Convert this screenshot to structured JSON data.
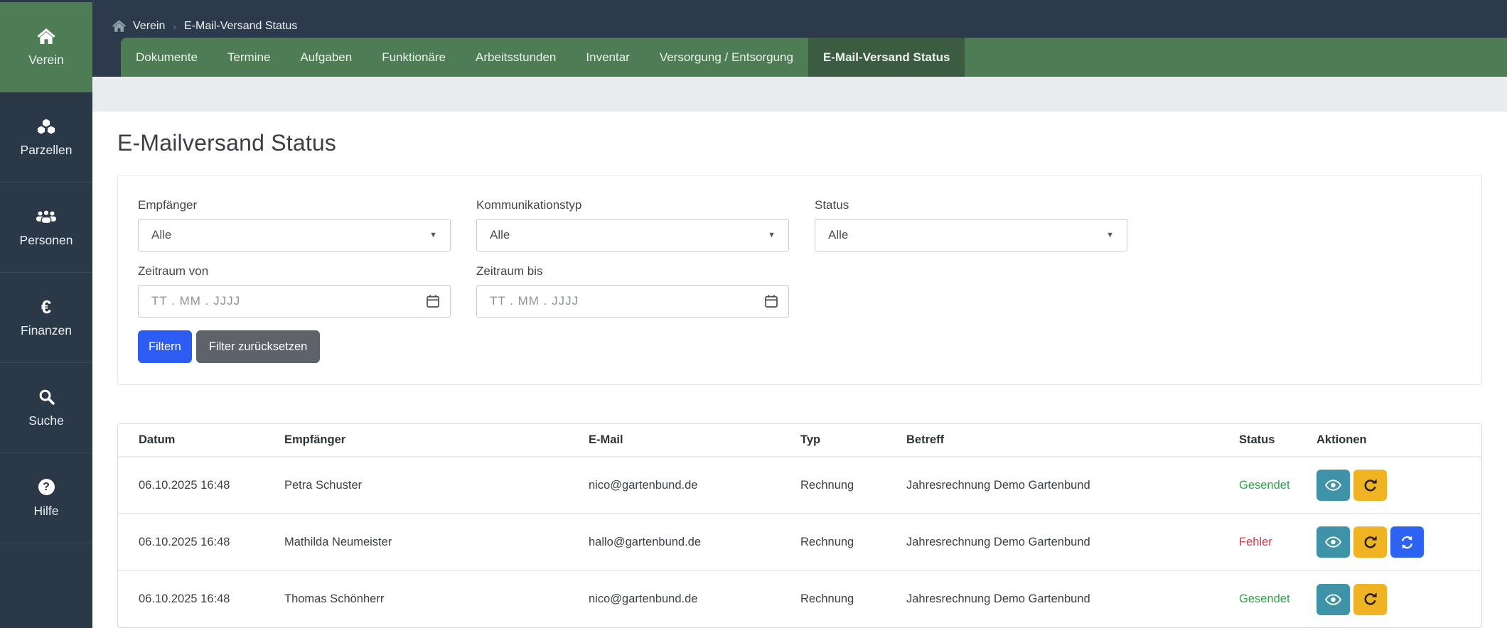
{
  "sidebar": {
    "items": [
      {
        "icon": "home-icon",
        "label": "Verein",
        "active": true
      },
      {
        "icon": "cubes-icon",
        "label": "Parzellen",
        "active": false
      },
      {
        "icon": "users-icon",
        "label": "Personen",
        "active": false
      },
      {
        "icon": "euro-icon",
        "label": "Finanzen",
        "active": false
      },
      {
        "icon": "search-icon",
        "label": "Suche",
        "active": false
      },
      {
        "icon": "help-icon",
        "label": "Hilfe",
        "active": false
      }
    ]
  },
  "breadcrumb": {
    "items": [
      "Verein",
      "E-Mail-Versand Status"
    ]
  },
  "tabs": [
    {
      "label": "Dokumente",
      "active": false
    },
    {
      "label": "Termine",
      "active": false
    },
    {
      "label": "Aufgaben",
      "active": false
    },
    {
      "label": "Funktionäre",
      "active": false
    },
    {
      "label": "Arbeitsstunden",
      "active": false
    },
    {
      "label": "Inventar",
      "active": false
    },
    {
      "label": "Versorgung / Entsorgung",
      "active": false
    },
    {
      "label": "E-Mail-Versand Status",
      "active": true
    }
  ],
  "page": {
    "title": "E-Mailversand Status"
  },
  "filters": {
    "empfaenger": {
      "label": "Empfänger",
      "value": "Alle"
    },
    "kommunikationstyp": {
      "label": "Kommunikationstyp",
      "value": "Alle"
    },
    "status": {
      "label": "Status",
      "value": "Alle"
    },
    "zeitraum_von": {
      "label": "Zeitraum von",
      "placeholder": "TT . MM . JJJJ"
    },
    "zeitraum_bis": {
      "label": "Zeitraum bis",
      "placeholder": "TT . MM . JJJJ"
    },
    "filter_button": "Filtern",
    "reset_button": "Filter zurücksetzen"
  },
  "table": {
    "columns": [
      "Datum",
      "Empfänger",
      "E-Mail",
      "Typ",
      "Betreff",
      "Status",
      "Aktionen"
    ],
    "rows": [
      {
        "datum": "06.10.2025 16:48",
        "empfaenger": "Petra Schuster",
        "email": "nico@gartenbund.de",
        "typ": "Rechnung",
        "betreff": "Jahresrechnung Demo Gartenbund",
        "status": "Gesendet",
        "status_type": "success",
        "actions": [
          "view",
          "resend"
        ]
      },
      {
        "datum": "06.10.2025 16:48",
        "empfaenger": "Mathilda Neumeister",
        "email": "hallo@gartenbund.de",
        "typ": "Rechnung",
        "betreff": "Jahresrechnung Demo Gartenbund",
        "status": "Fehler",
        "status_type": "error",
        "actions": [
          "view",
          "resend",
          "retry"
        ]
      },
      {
        "datum": "06.10.2025 16:48",
        "empfaenger": "Thomas Schönherr",
        "email": "nico@gartenbund.de",
        "typ": "Rechnung",
        "betreff": "Jahresrechnung Demo Gartenbund",
        "status": "Gesendet",
        "status_type": "success",
        "actions": [
          "view",
          "resend"
        ]
      }
    ]
  },
  "colors": {
    "sidebar_dark": "#2b3847",
    "header_dark": "#2c3a4b",
    "nav_green": "#4e7d55",
    "nav_green_active": "#3c5c42",
    "primary_blue": "#2c5cf2",
    "secondary_gray": "#5d6369",
    "action_view_teal": "#3e93a8",
    "action_resend_yellow": "#f0b323",
    "action_retry_blue": "#2d63f0",
    "status_success": "#28a745",
    "status_error": "#dc3545"
  }
}
